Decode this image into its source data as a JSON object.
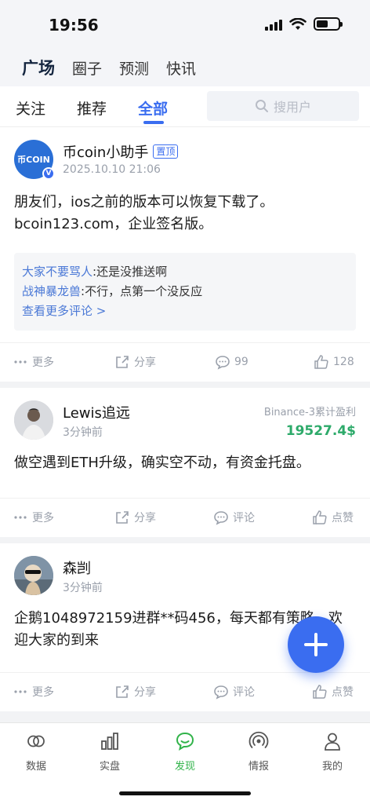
{
  "status_bar": {
    "time": "19:56"
  },
  "top_nav": {
    "items": [
      "广场",
      "圈子",
      "预测",
      "快讯"
    ],
    "active": "广场"
  },
  "sub_tabs": {
    "items": [
      "关注",
      "推荐",
      "全部"
    ],
    "active": "全部"
  },
  "search": {
    "placeholder": "搜用户"
  },
  "posts": [
    {
      "author": "币coin小助手",
      "avatar_text": "币COIN",
      "badge": "置顶",
      "time": "2025.10.10 21:06",
      "content": "朋友们，ios之前的版本可以恢复下载了。bcoin123.com，企业签名版。",
      "comments": [
        {
          "user": "大家不要骂人",
          "text": ":还是没推送啊"
        },
        {
          "user": "战神暴龙兽",
          "text": ":不行，点第一个没反应"
        }
      ],
      "more_comments": "查看更多评论 >",
      "actions": {
        "more": "更多",
        "share": "分享",
        "comment": "99",
        "like": "128"
      }
    },
    {
      "author": "Lewis追远",
      "time": "3分钟前",
      "pnl_label": "Binance-3累计盈利",
      "pnl_value": "19527.4$",
      "content": "做空遇到ETH升级，确实空不动，有资金托盘。",
      "actions": {
        "more": "更多",
        "share": "分享",
        "comment": "评论",
        "like": "点赞"
      }
    },
    {
      "author": "森剀",
      "time": "3分钟前",
      "content": "企鹅1048972159进群**码456，每天都有策略，欢迎大家的到来",
      "actions": {
        "more": "更多",
        "share": "分享",
        "comment": "评论",
        "like": "点赞"
      }
    }
  ],
  "bottom_nav": {
    "items": [
      {
        "label": "数据",
        "icon": "data-icon"
      },
      {
        "label": "实盘",
        "icon": "bar-chart-icon"
      },
      {
        "label": "发现",
        "icon": "discover-chat-icon"
      },
      {
        "label": "情报",
        "icon": "broadcast-icon"
      },
      {
        "label": "我的",
        "icon": "profile-icon"
      }
    ],
    "active": "发现"
  },
  "colors": {
    "accent": "#3a6df0",
    "active_green": "#31b34a",
    "profit_green": "#2daa6a",
    "link_blue": "#4a78d6"
  }
}
